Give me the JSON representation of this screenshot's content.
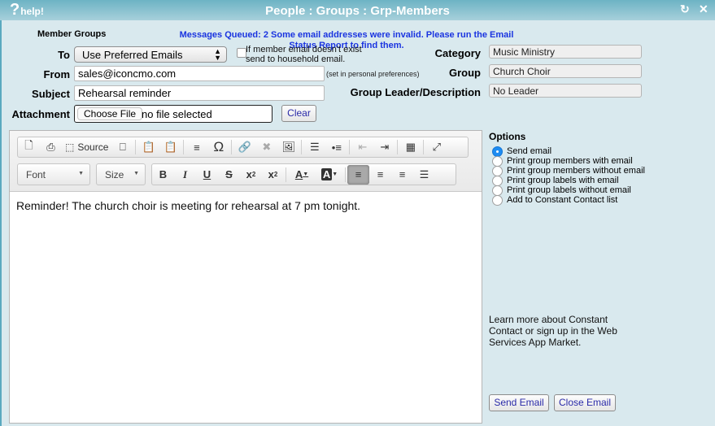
{
  "window": {
    "title": "People : Groups : Grp-Members",
    "help_label": "help!",
    "help_icon": "question-mark-icon",
    "refresh_icon": "refresh-icon",
    "close_icon": "close-icon"
  },
  "header": {
    "member_groups_label": "Member Groups",
    "message": "Messages Queued: 2 Some email addresses were invalid. Please run the Email Status Report to find them."
  },
  "form": {
    "to_label": "To",
    "to_value": "Use Preferred Emails",
    "household_checkbox_label_1": "If member email doesn't exist",
    "household_checkbox_label_2": "send to household email.",
    "household_checked": false,
    "from_label": "From",
    "from_value": "sales@iconcmo.com",
    "from_hint": "(set in personal preferences)",
    "subject_label": "Subject",
    "subject_value": "Rehearsal reminder",
    "attachment_label": "Attachment",
    "choose_file_label": "Choose File",
    "file_status": "no file selected",
    "clear_label": "Clear"
  },
  "group_info": {
    "category_label": "Category",
    "category_value": "Music Ministry",
    "group_label": "Group",
    "group_value": "Church Choir",
    "leader_label": "Group Leader/Description",
    "leader_value": "No Leader"
  },
  "editor": {
    "source_label": "Source",
    "font_label": "Font",
    "size_label": "Size",
    "content": "Reminder! The church choir is meeting for rehearsal at 7 pm tonight.",
    "active_alignment": "left"
  },
  "options": {
    "title": "Options",
    "items": [
      {
        "label": "Send email",
        "selected": true
      },
      {
        "label": "Print group members with email",
        "selected": false
      },
      {
        "label": "Print group members without email",
        "selected": false
      },
      {
        "label": "Print group labels with email",
        "selected": false
      },
      {
        "label": "Print group labels without email",
        "selected": false
      },
      {
        "label": "Add to Constant Contact list",
        "selected": false
      }
    ],
    "learn_more": "Learn more about Constant Contact or sign up in the Web Services App Market."
  },
  "actions": {
    "send_label": "Send Email",
    "close_label": "Close Email"
  }
}
